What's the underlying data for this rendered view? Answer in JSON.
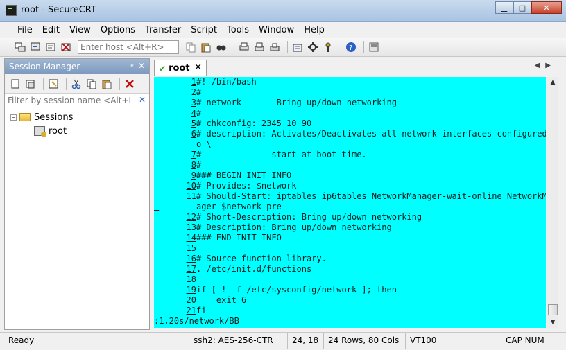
{
  "window": {
    "title": "root - SecureCRT",
    "minimize": "▁",
    "maximize": "□",
    "close": "✕"
  },
  "menu": [
    "File",
    "Edit",
    "View",
    "Options",
    "Transfer",
    "Script",
    "Tools",
    "Window",
    "Help"
  ],
  "toolbar": {
    "host_placeholder": "Enter host <Alt+R>"
  },
  "session_manager": {
    "title": "Session Manager",
    "pin": "ᵖ",
    "close": "✕",
    "filter_placeholder": "Filter by session name <Alt+I>",
    "filter_clear": "✕",
    "tree": {
      "folder": "Sessions",
      "expander": "−",
      "session": "root"
    }
  },
  "tab": {
    "label": "root",
    "check": "✔",
    "close": "✕",
    "nav": "◀▶"
  },
  "terminal": {
    "lines": [
      {
        "n": "1",
        "text": "#! /bin/bash"
      },
      {
        "n": "2",
        "text": "#"
      },
      {
        "n": "3",
        "text": "# network       Bring up/down networking"
      },
      {
        "n": "4",
        "text": "#"
      },
      {
        "n": "5",
        "text": "# chkconfig: 2345 10 90"
      },
      {
        "n": "6",
        "text": "# description: Activates/Deactivates all network interfaces configured t"
      },
      {
        "n": "",
        "text": "o \\"
      },
      {
        "n": "7",
        "text": "#              start at boot time."
      },
      {
        "n": "8",
        "text": "#"
      },
      {
        "n": "9",
        "text": "### BEGIN INIT INFO"
      },
      {
        "n": "10",
        "text": "# Provides: $network"
      },
      {
        "n": "11",
        "text": "# Should-Start: iptables ip6tables NetworkManager-wait-online NetworkMan"
      },
      {
        "n": "",
        "text": "ager $network-pre"
      },
      {
        "n": "12",
        "text": "# Short-Description: Bring up/down networking"
      },
      {
        "n": "13",
        "text": "# Description: Bring up/down networking"
      },
      {
        "n": "14",
        "text": "### END INIT INFO"
      },
      {
        "n": "15",
        "text": ""
      },
      {
        "n": "16",
        "text": "# Source function library."
      },
      {
        "n": "17",
        "text": ". /etc/init.d/functions"
      },
      {
        "n": "18",
        "text": ""
      },
      {
        "n": "19",
        "text": "if [ ! -f /etc/sysconfig/network ]; then"
      },
      {
        "n": "20",
        "text": "    exit 6"
      },
      {
        "n": "21",
        "text": "fi"
      }
    ],
    "command_line": ":1,20s/network/BB"
  },
  "statusbar": {
    "ready": "Ready",
    "protocol": "ssh2: AES-256-CTR",
    "cursor": "24,  18",
    "size": "24 Rows, 80 Cols",
    "emulation": "VT100",
    "caps": "CAP  NUM"
  },
  "colors": {
    "terminal_bg": "#00ffff",
    "terminal_fg": "#002020"
  }
}
